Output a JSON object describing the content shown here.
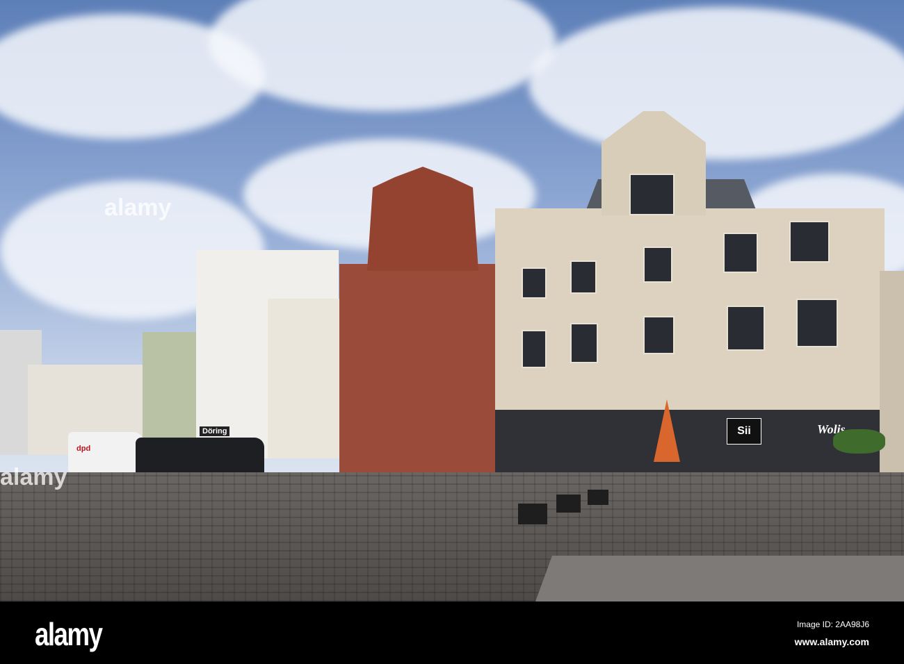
{
  "photo": {
    "signs": {
      "van": "dpd",
      "shop_left": "Döring",
      "shop_right": "Sii",
      "shop_far_right": "Wolis"
    },
    "watermark": "alamy"
  },
  "footer": {
    "logo": "alamy",
    "image_id": "Image ID: 2AA98J6",
    "website": "www.alamy.com"
  }
}
